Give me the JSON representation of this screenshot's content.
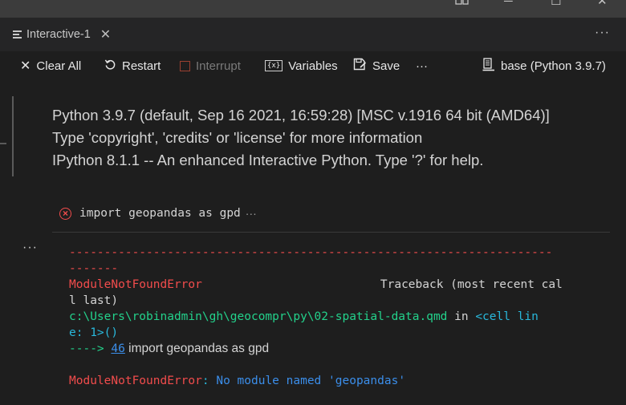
{
  "window": {
    "controls": {
      "layout_icon": "layout-icon",
      "minimize": "─",
      "maximize": "☐",
      "close": "✕"
    }
  },
  "tab": {
    "label": "Interactive-1",
    "close_symbol": "✕",
    "more_symbol": "···"
  },
  "toolbar": {
    "clear_all": "Clear All",
    "restart": "Restart",
    "interrupt": "Interrupt",
    "variables": "Variables",
    "variables_icon_text": "{x}",
    "save": "Save",
    "more": "···",
    "kernel": "base (Python 3.9.7)"
  },
  "banner": {
    "line1": "Python 3.9.7 (default, Sep 16 2021, 16:59:28) [MSC v.1916 64 bit (AMD64)]",
    "line2": "Type 'copyright', 'credits' or 'license' for more information",
    "line3": "IPython 8.1.1 -- An enhanced Interactive Python. Type '?' for help."
  },
  "cell": {
    "status_icon": "error-circle-icon",
    "code": "import geopandas as gpd",
    "ellipsis": "···",
    "output_more": "···"
  },
  "output": {
    "dashes1": "---------------------------------------------------------------------",
    "dashes2": "-------",
    "error_name": "ModuleNotFoundError",
    "traceback_label": "Traceback (most recent cal",
    "traceback_cont": "l last)",
    "path": "c:\\Users\\robinadmin\\gh\\geocompr\\py\\02-spatial-data.qmd",
    "in_text": " in ",
    "cell_ref1": "<cell lin",
    "cell_ref2": "e: 1>()",
    "arrow": "----> ",
    "line_no": "46",
    "arrow_code": " import geopandas as gpd",
    "final_error_name": "ModuleNotFoundError",
    "final_error_colon": ": ",
    "final_error_msg": "No module named 'geopandas'"
  },
  "colors": {
    "background": "#1e1e1e",
    "error_red": "#f14c4c",
    "path_green": "#23d18b",
    "link_blue": "#3b8eea"
  }
}
